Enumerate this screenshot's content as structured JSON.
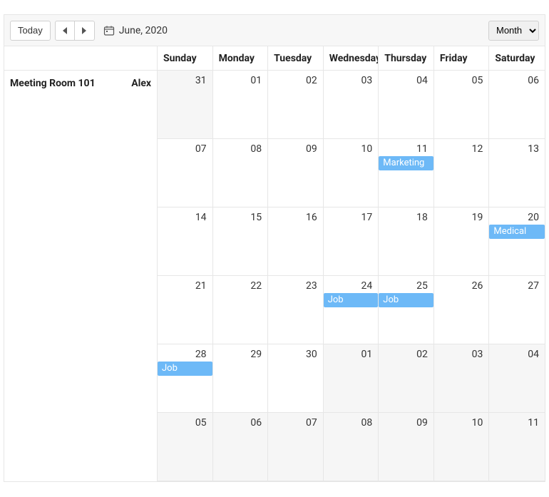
{
  "toolbar": {
    "today_label": "Today",
    "period_label": "June, 2020",
    "view_value": "Month",
    "view_options": [
      "Month"
    ]
  },
  "resources": {
    "room": "Meeting Room 101",
    "person": "Alex"
  },
  "day_headers": [
    "Sunday",
    "Monday",
    "Tuesday",
    "Wednesday",
    "Thursday",
    "Friday",
    "Saturday"
  ],
  "weeks": [
    [
      {
        "date": "31",
        "out": true
      },
      {
        "date": "01"
      },
      {
        "date": "02"
      },
      {
        "date": "03"
      },
      {
        "date": "04"
      },
      {
        "date": "05"
      },
      {
        "date": "06"
      }
    ],
    [
      {
        "date": "07"
      },
      {
        "date": "08"
      },
      {
        "date": "09"
      },
      {
        "date": "10"
      },
      {
        "date": "11",
        "event": "Marketing"
      },
      {
        "date": "12"
      },
      {
        "date": "13"
      }
    ],
    [
      {
        "date": "14"
      },
      {
        "date": "15"
      },
      {
        "date": "16"
      },
      {
        "date": "17"
      },
      {
        "date": "18"
      },
      {
        "date": "19"
      },
      {
        "date": "20",
        "event": "Medical"
      }
    ],
    [
      {
        "date": "21"
      },
      {
        "date": "22"
      },
      {
        "date": "23"
      },
      {
        "date": "24",
        "event": "Job"
      },
      {
        "date": "25",
        "event": "Job"
      },
      {
        "date": "26"
      },
      {
        "date": "27"
      }
    ],
    [
      {
        "date": "28",
        "event": "Job"
      },
      {
        "date": "29"
      },
      {
        "date": "30"
      },
      {
        "date": "01",
        "out": true
      },
      {
        "date": "02",
        "out": true
      },
      {
        "date": "03",
        "out": true
      },
      {
        "date": "04",
        "out": true
      }
    ],
    [
      {
        "date": "05",
        "out": true
      },
      {
        "date": "06",
        "out": true
      },
      {
        "date": "07",
        "out": true
      },
      {
        "date": "08",
        "out": true
      },
      {
        "date": "09",
        "out": true
      },
      {
        "date": "10",
        "out": true
      },
      {
        "date": "11",
        "out": true
      }
    ]
  ]
}
